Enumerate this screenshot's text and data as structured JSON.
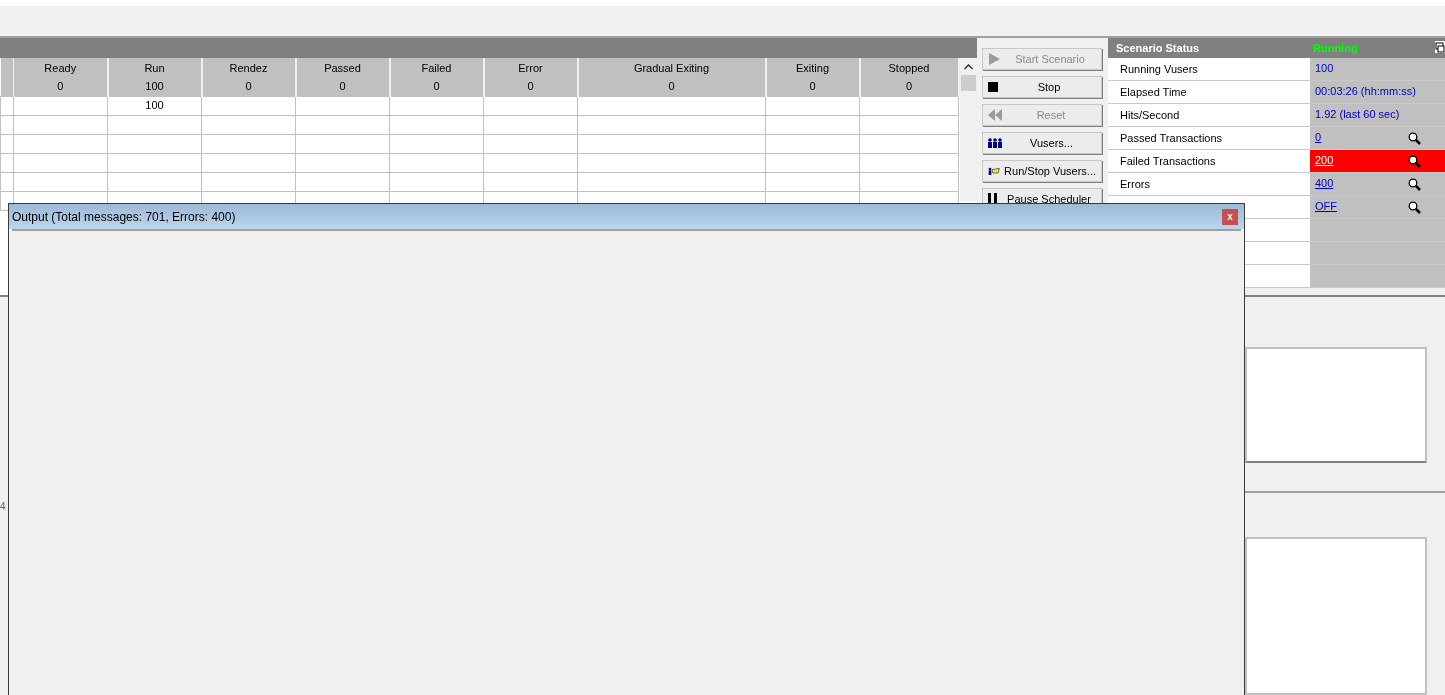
{
  "vusers_table": {
    "columns": [
      {
        "label": "Ready",
        "count": "0"
      },
      {
        "label": "Run",
        "count": "100"
      },
      {
        "label": "Rendez",
        "count": "0"
      },
      {
        "label": "Passed",
        "count": "0"
      },
      {
        "label": "Failed",
        "count": "0"
      },
      {
        "label": "Error",
        "count": "0"
      },
      {
        "label": "Gradual Exiting",
        "count": "0"
      },
      {
        "label": "Exiting",
        "count": "0"
      },
      {
        "label": "Stopped",
        "count": "0"
      }
    ],
    "rows": [
      [
        "",
        "100",
        "",
        "",
        "",
        "",
        "",
        "",
        ""
      ],
      [
        "",
        "",
        "",
        "",
        "",
        "",
        "",
        "",
        ""
      ],
      [
        "",
        "",
        "",
        "",
        "",
        "",
        "",
        "",
        ""
      ],
      [
        "",
        "",
        "",
        "",
        "",
        "",
        "",
        "",
        ""
      ],
      [
        "",
        "",
        "",
        "",
        "",
        "",
        "",
        "",
        ""
      ],
      [
        "",
        "",
        "",
        "",
        "",
        "",
        "",
        "",
        ""
      ]
    ]
  },
  "buttons": [
    {
      "kind": "play",
      "label": "Start Scenario",
      "disabled": true
    },
    {
      "kind": "stop",
      "label": "Stop",
      "disabled": false
    },
    {
      "kind": "rewind",
      "label": "Reset",
      "disabled": true
    },
    {
      "kind": "users",
      "label": "Vusers...",
      "disabled": false
    },
    {
      "kind": "runstop",
      "label": "Run/Stop Vusers...",
      "disabled": false
    },
    {
      "kind": "pause",
      "label": "Pause Scheduler",
      "disabled": false
    }
  ],
  "scenario_status": {
    "title": "Scenario Status",
    "state": "Running",
    "rows": [
      {
        "kind": "text",
        "label": "Running Vusers",
        "value": "100",
        "alert": false
      },
      {
        "kind": "text",
        "label": "Elapsed Time",
        "value": "00:03:26 (hh:mm:ss)",
        "alert": false
      },
      {
        "kind": "text",
        "label": "Hits/Second",
        "value": "1.92 (last 60 sec)",
        "alert": false
      },
      {
        "kind": "link",
        "label": "Passed Transactions",
        "value": "0",
        "alert": false
      },
      {
        "kind": "link",
        "label": "Failed Transactions",
        "value": "200",
        "alert": true
      },
      {
        "kind": "link",
        "label": "Errors",
        "value": "400",
        "alert": false
      },
      {
        "kind": "link",
        "label": "",
        "value": "OFF",
        "alert": false
      },
      {
        "kind": "empty",
        "label": "",
        "value": "",
        "alert": false
      },
      {
        "kind": "empty",
        "label": "",
        "value": "",
        "alert": false
      },
      {
        "kind": "empty",
        "label": "",
        "value": "",
        "alert": false
      }
    ]
  },
  "axis_label": "4",
  "output_window": {
    "title": "Output (Total messages: 701,  Errors: 400)",
    "close": "x"
  }
}
